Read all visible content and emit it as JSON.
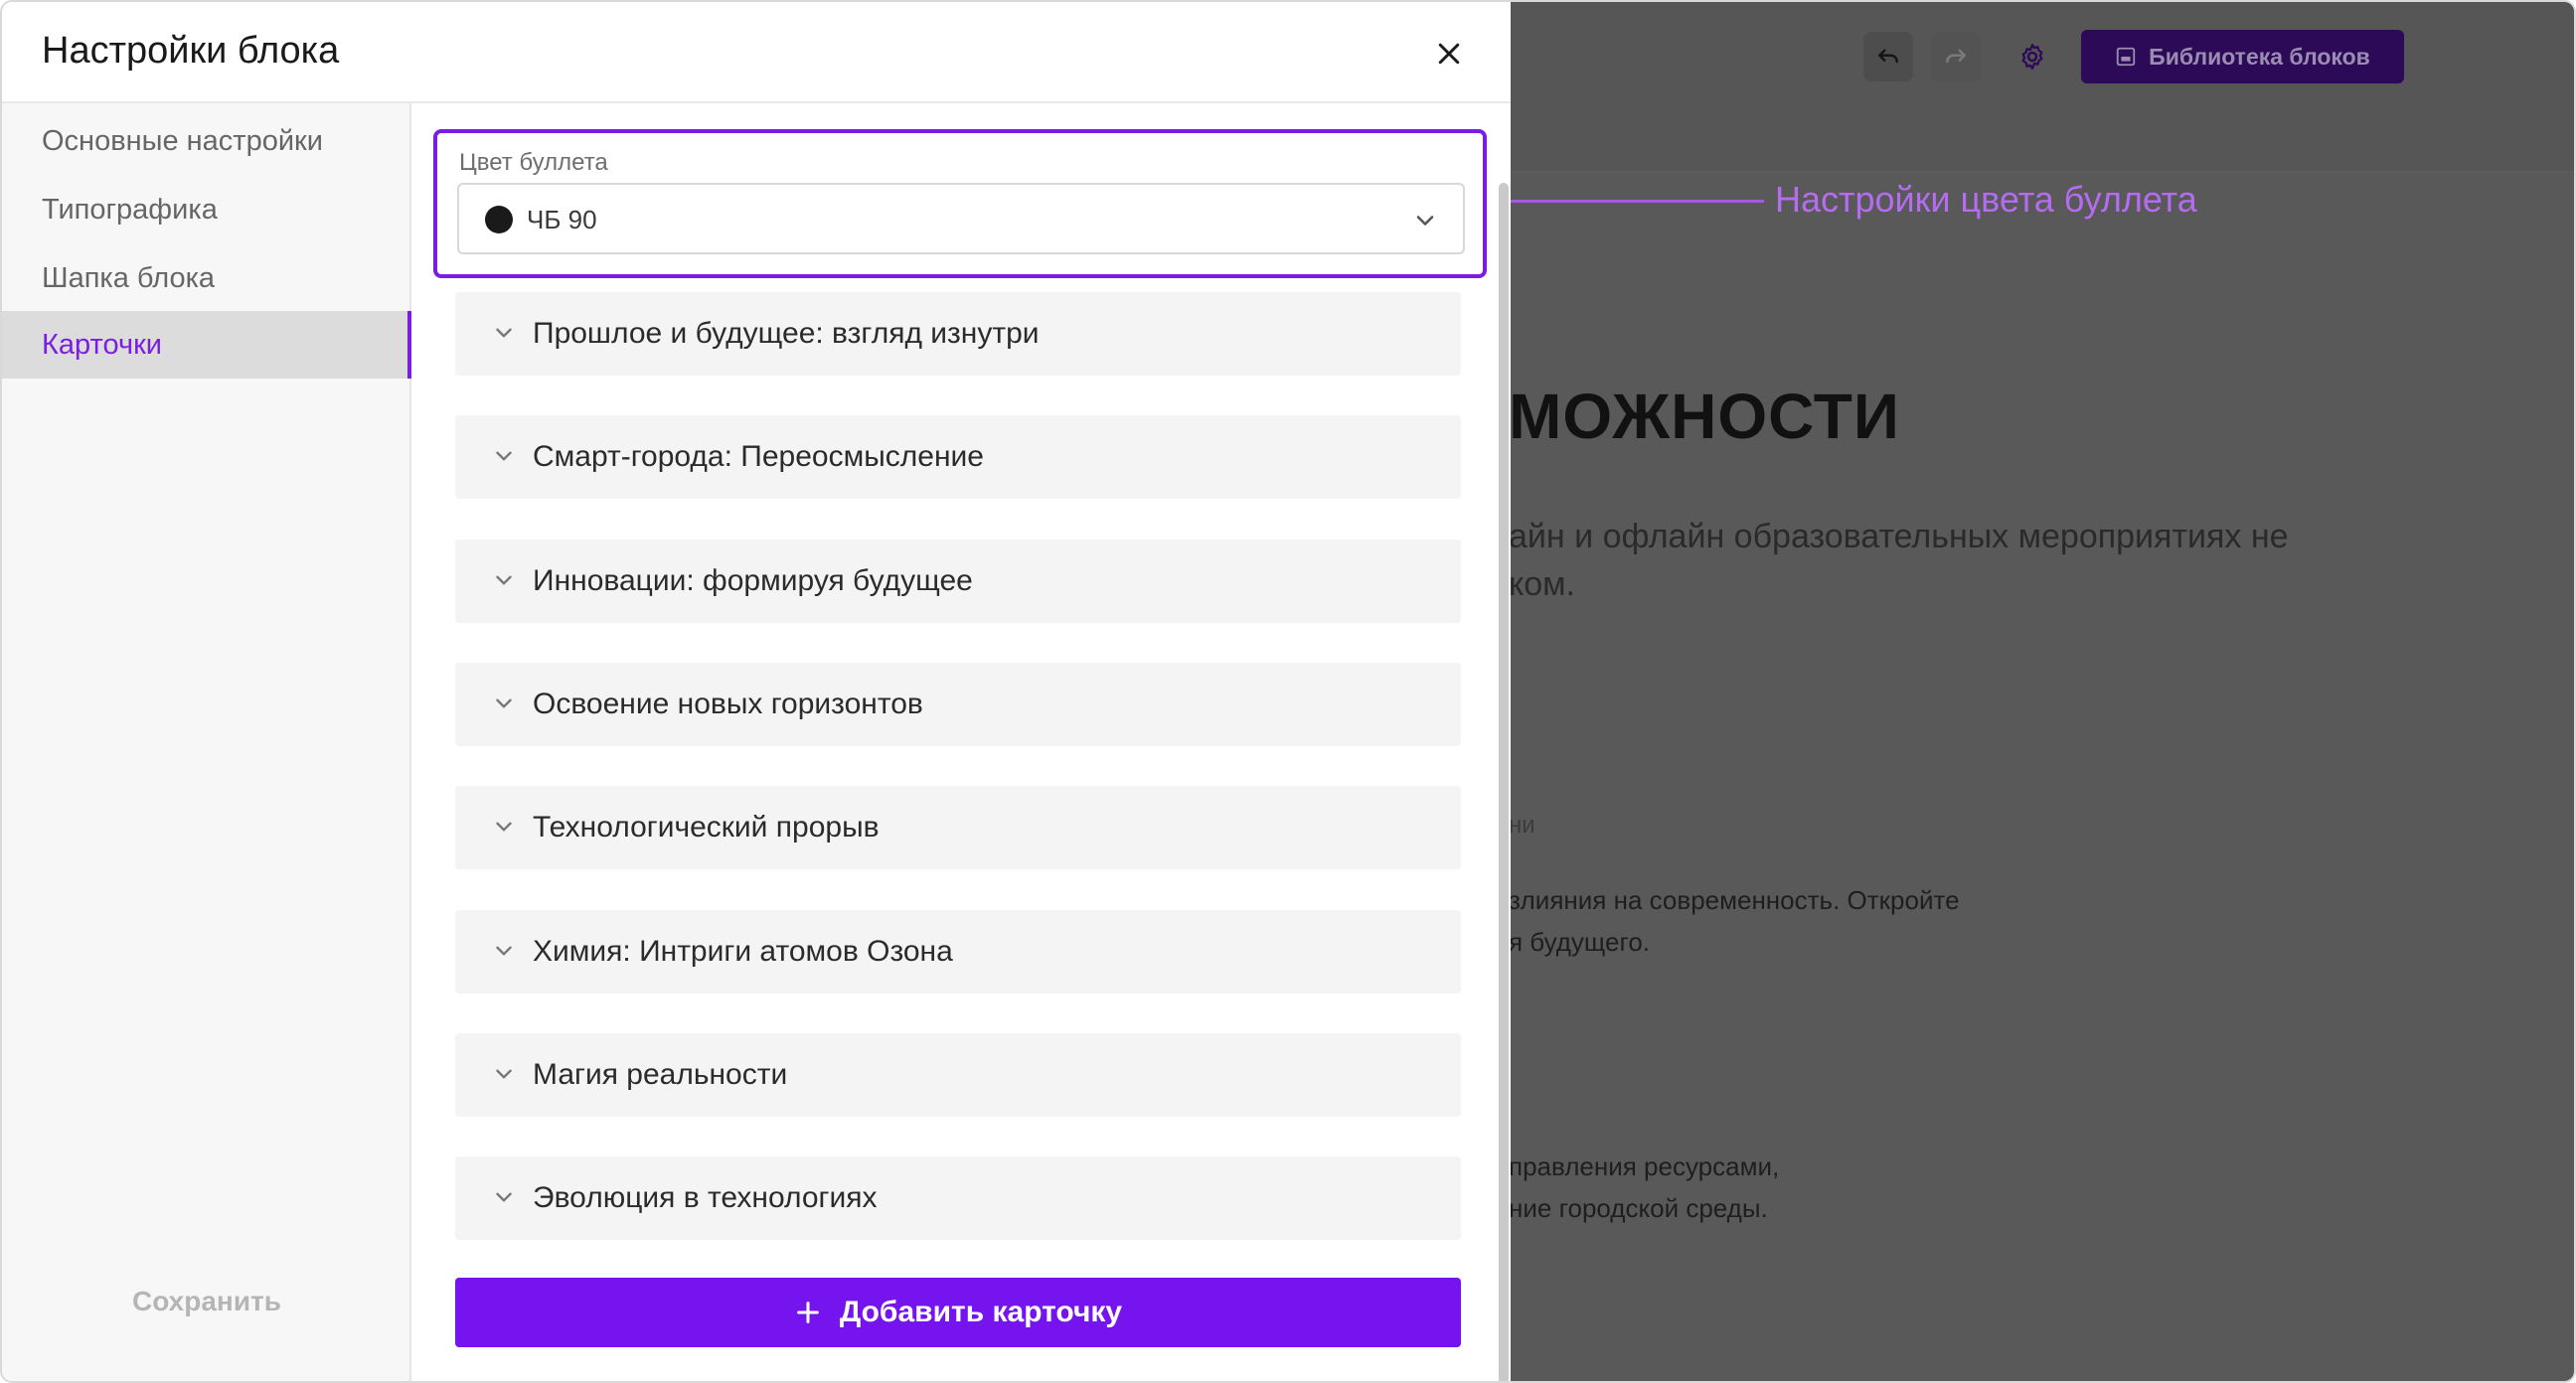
{
  "modal": {
    "title": "Настройки блока",
    "sidebar": {
      "items": [
        {
          "label": "Основные настройки",
          "active": false
        },
        {
          "label": "Типографика",
          "active": false
        },
        {
          "label": "Шапка блока",
          "active": false
        },
        {
          "label": "Карточки",
          "active": true
        }
      ],
      "save_label": "Сохранить"
    },
    "bullet_color": {
      "label": "Цвет буллета",
      "value": "ЧБ 90",
      "swatch": "#1a1a1a"
    },
    "cards": [
      "Прошлое и будущее: взгляд изнутри",
      "Смарт-города: Переосмысление",
      "Инновации: формируя будущее",
      "Освоение новых горизонтов",
      "Технологический прорыв",
      "Химия: Интриги атомов Озона",
      "Магия реальности",
      "Эволюция в технологиях"
    ],
    "add_card_label": "Добавить карточку"
  },
  "annotation": {
    "text": "Настройки цвета буллета"
  },
  "editor": {
    "library_label": "Библиотека блоков",
    "heading": "можности",
    "lead_line1": "айн и офлайн образовательных мероприятиях не",
    "lead_line2": "ком.",
    "card_label": "ни",
    "card1_line1": "злияния на современность. Откройте",
    "card1_line2": "я будущего.",
    "card2_line1": "правления ресурсами,",
    "card2_line2": "ние городской среды."
  },
  "colors": {
    "accent": "#7614f0",
    "highlight_border": "#7b1be6",
    "annotation": "#b46cf0"
  }
}
